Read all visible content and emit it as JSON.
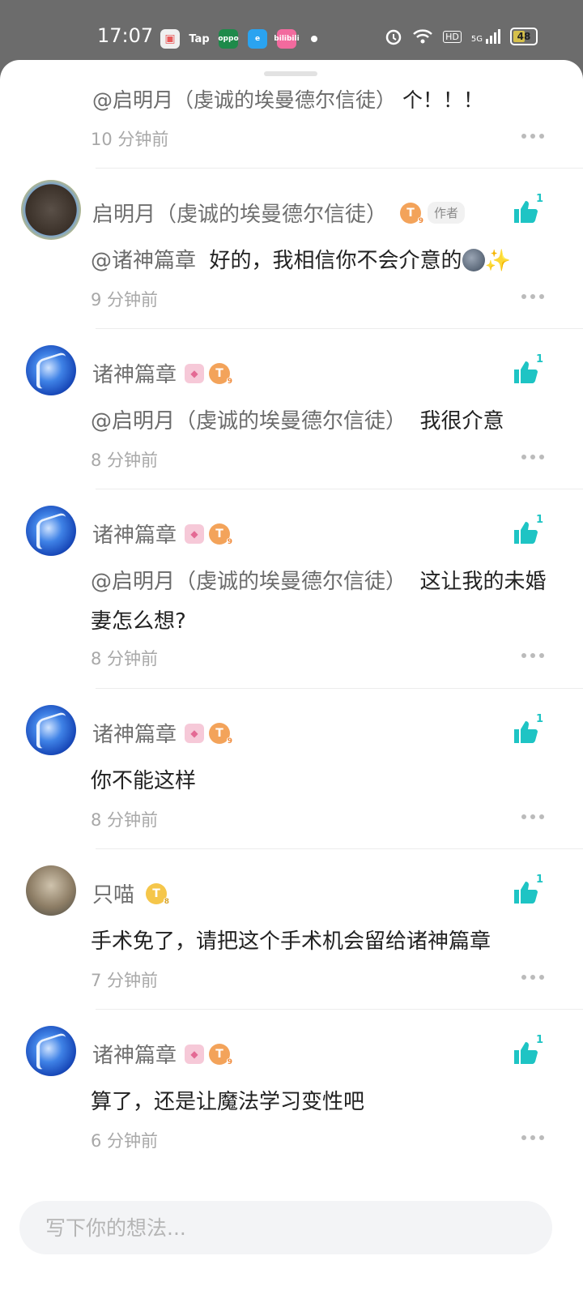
{
  "status_bar": {
    "time": "17:07",
    "apps": [
      "bilibili-game-icon",
      "Tap",
      "oppo",
      "e-icon",
      "bilibili"
    ],
    "battery": "48",
    "signal": "5G",
    "hd": "HD"
  },
  "first": {
    "mention": "@启明月（虔诚的埃曼德尔信徒）",
    "text": "个！！！",
    "time": "10 分钟前"
  },
  "comments": [
    {
      "name": "启明月（虔诚的埃曼德尔信徒）",
      "author_tag": "作者",
      "mention": "@诸神篇章",
      "text": "好的，我相信你不会介意的",
      "sparkle": "✨",
      "time": "9 分钟前",
      "likes": "1"
    },
    {
      "name": "诸神篇章",
      "mention": "@启明月（虔诚的埃曼德尔信徒）",
      "text": "我很介意",
      "time": "8 分钟前",
      "likes": "1"
    },
    {
      "name": "诸神篇章",
      "mention": "@启明月（虔诚的埃曼德尔信徒）",
      "text": "这让我的未婚妻怎么想?",
      "time": "8 分钟前",
      "likes": "1"
    },
    {
      "name": "诸神篇章",
      "text": "你不能这样",
      "time": "8 分钟前",
      "likes": "1"
    },
    {
      "name": "只喵",
      "text": "手术免了，请把这个手术机会留给诸神篇章",
      "time": "7 分钟前",
      "likes": "1"
    },
    {
      "name": "诸神篇章",
      "text": "算了，还是让魔法学习变性吧",
      "time": "6 分钟前",
      "likes": "1"
    }
  ],
  "badge_letter": "T",
  "badge_level": "9",
  "badge_level_gold": "8",
  "input": {
    "placeholder": "写下你的想法..."
  },
  "colors": {
    "accent": "#1ec4c4",
    "badge_orange": "#f3a35a",
    "badge_gold": "#f5c64a"
  }
}
